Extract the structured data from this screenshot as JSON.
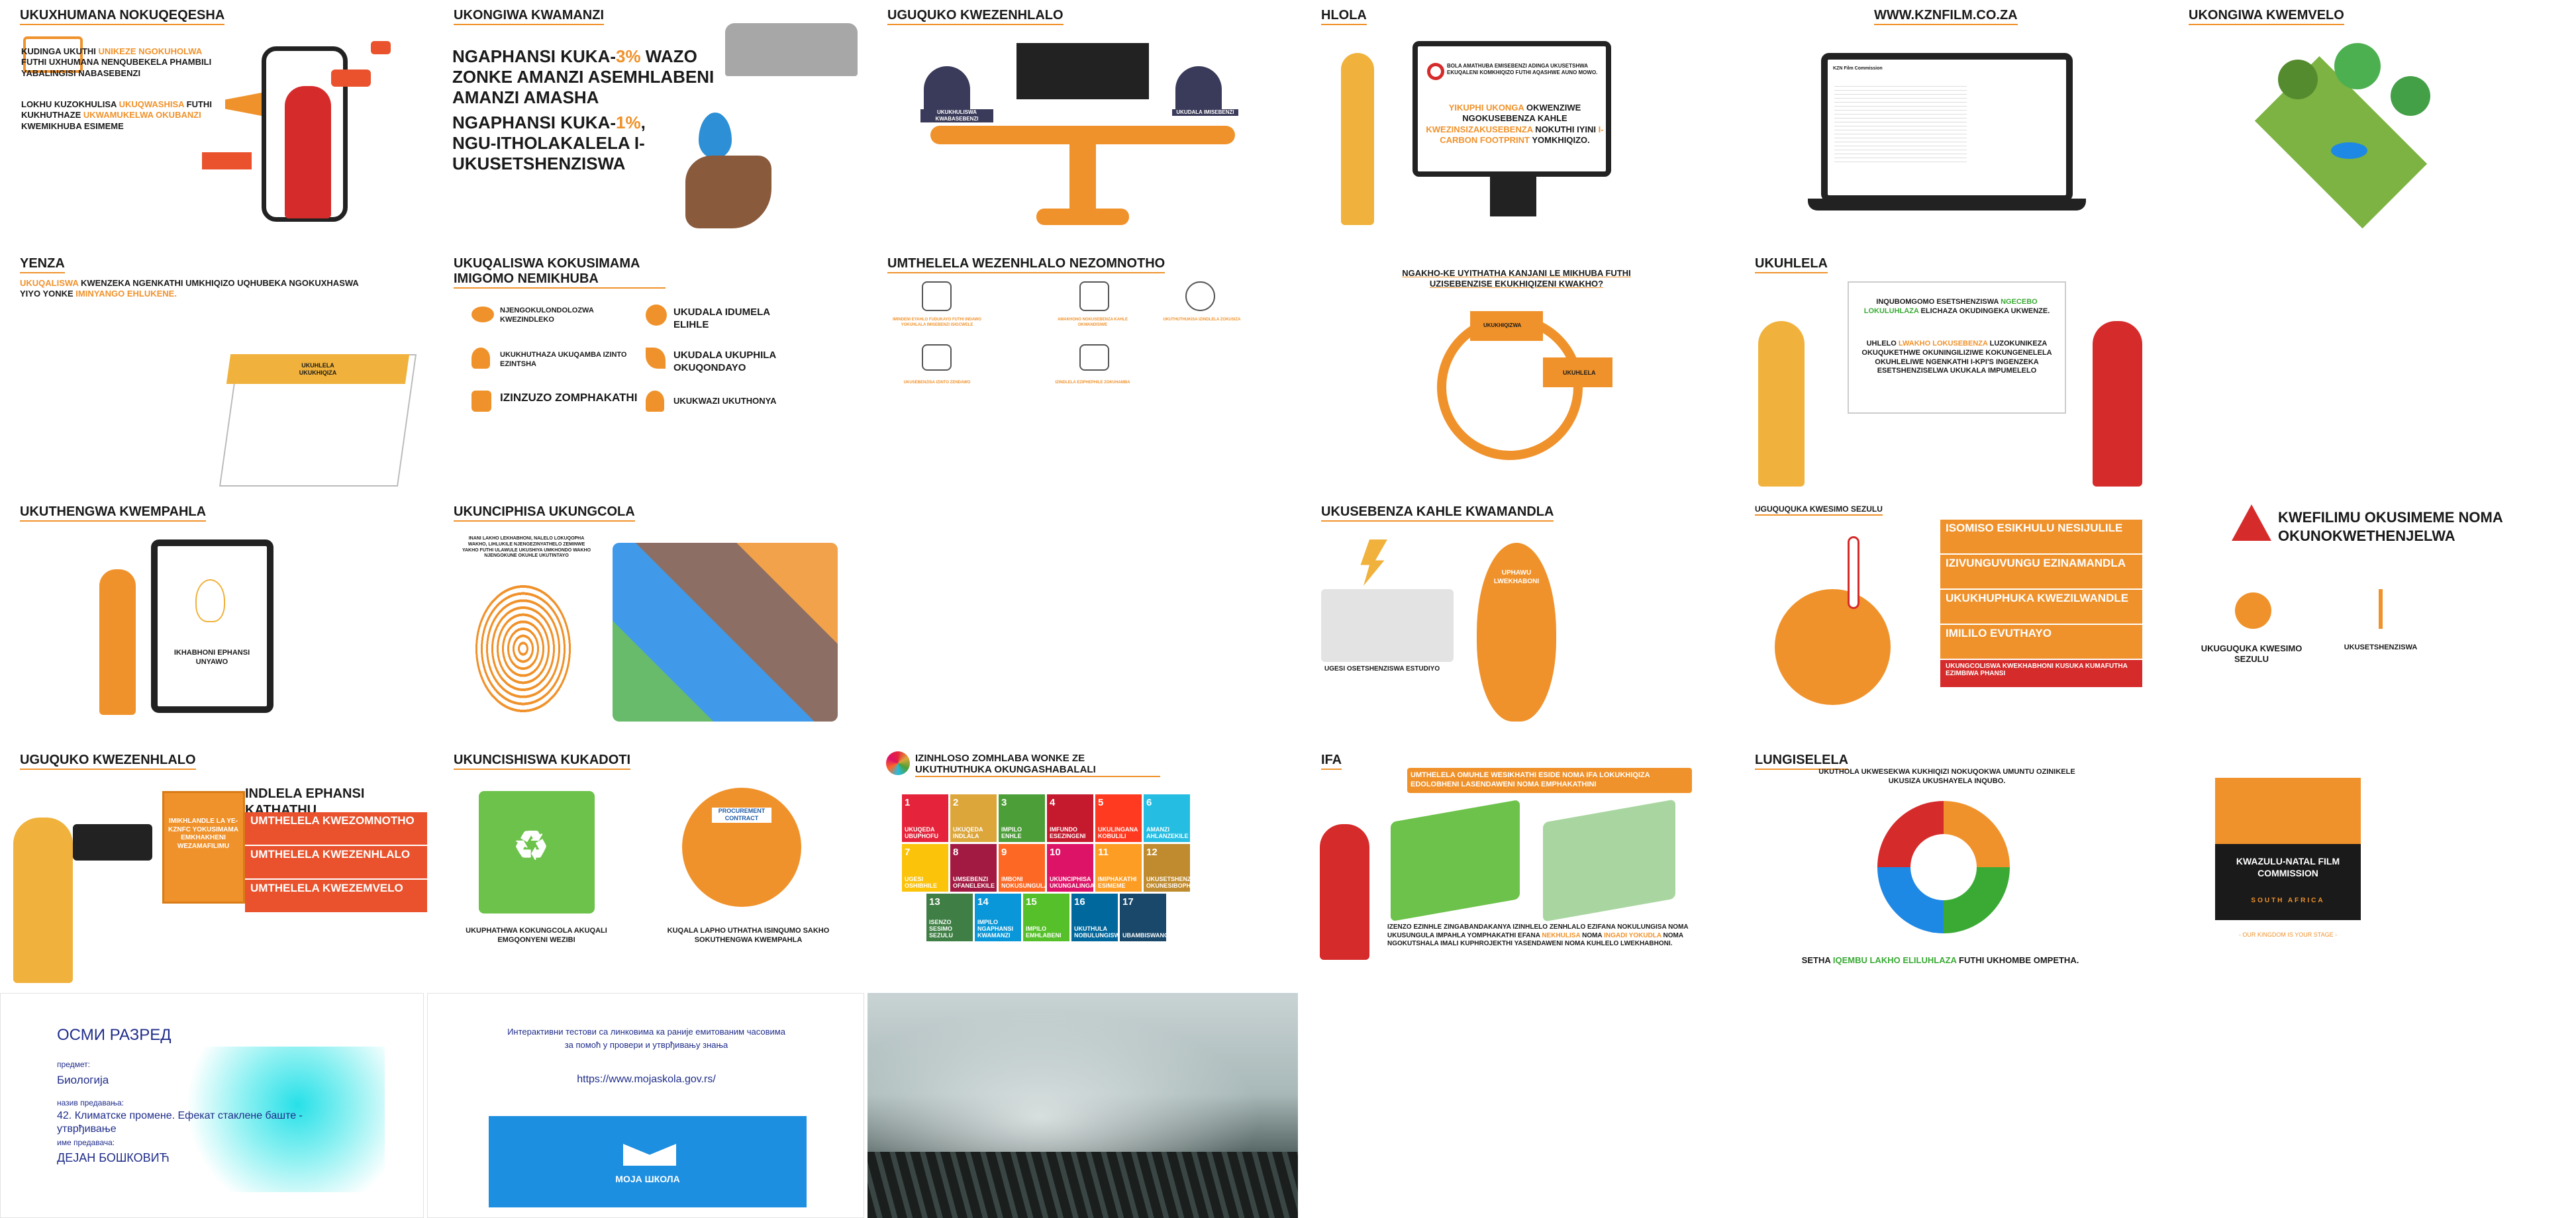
{
  "slides": [
    {
      "title": "UKUXHUMANA NOKUQEQESHA",
      "p1": [
        "KUDINGA UKUTHI ",
        "UNIKEZE NGOKUHOLWA",
        " FUTHI UXHUMANA NENQUBEKELA PHAMBILI YABALINGISI NABASEBENZI"
      ],
      "p2": [
        "LOKHU KUZOKHULISA ",
        "UKUQWASHISA",
        " FUTHI KUKHUTHAZE ",
        "UKWAMUKELWA OKUBANZI",
        " KWEMIKHUBA ESIMEME"
      ]
    },
    {
      "title": "UKONGIWA KWAMANZI",
      "l1": [
        "NGAPHANSI KUKA-",
        "3%",
        " WAZO ZONKE AMANZI ASEMHLABENI AMANZI AMASHA"
      ],
      "l2": [
        "NGAPHANSI KUKA-",
        "1%",
        ", NGU-ITHOLAKALELA I-UKUSETSHENZISWA"
      ]
    },
    {
      "title": "UGUQUKO KWEZENHLALO",
      "left": "UKUKHULISWA KWABASEBENZI",
      "right": "UKUDALA IMISEBENZI"
    },
    {
      "title": "HLOLA",
      "p1": "BOLA AMATHUBA EMISEBENZI ADINGA UKUSETSHWA EKUQALENI KOMKHIQIZO FUTHI AQASHWE AUNO MOWO.",
      "p2": [
        "YIKUPHI UKONGA",
        " OKWENZIWE NGOKUSEBENZA KAHLE ",
        "KWEZINSIZAKUSEBENZA",
        " NOKUTHI IYINI ",
        "I-CARBON FOOTPRINT",
        " YOMKHIQIZO."
      ]
    },
    {
      "title": "WWW.KZNFILM.CO.ZA",
      "site": "KZN Film Commission"
    },
    {
      "title": "UKONGIWA KWEMVELO"
    },
    {
      "title": "YENZA",
      "p1": [
        "UKUQALISWA",
        " KWENZEKA NGENKATHI UMKHIQIZO UQHUBEKA NGOKUXHASWA YIYO YONKE ",
        "IMINYANGO EHLUKENE."
      ],
      "cal": "UKUHLELA UKUKHIQIZA"
    },
    {
      "title": "UKUQALISWA KOKUSIMAMA IMIGOMO NEMIKHUBA",
      "items": [
        "NJENGOKULONDOLOZWA KWEZINDLEKO",
        "UKUDALA IDUMELA ELIHLE",
        "UKUKHUTHAZA UKUQAMBA IZINTO EZINTSHA",
        "UKUDALA UKUPHILA OKUQONDAYO",
        "IZINZUZO ZOMPHAKATHI",
        "UKUKWAZI UKUTHONYA"
      ]
    },
    {
      "title": "UMTHELELA WEZENHLALO NEZOMNOTHO",
      "items": [
        "IMINDENI EYAHLO FUDUKAYO FUTHI INDAWO YOKUHLALA IMISEBENZI ISIGCWELE",
        "AMAKHONO NOKUSEBENZA KAHLE OKWANDISIWE",
        "UKUTHUTHUKISA IZINDLELA ZOKUSIZA",
        "UKUSEBENZISA IZINTO ZENDAWO",
        "IZINDLELA EZIPHEPHILE ZOKUHAMBA",
        "IMIPHUMELA EHLE YEZEMPILO"
      ]
    },
    {
      "title": "",
      "q": "NGAKHO-KE UYITHATHA KANJANI LE MIKHUBA FUTHI UZISEBENZISE EKUKHIQIZENI KWAKHO?",
      "a": "UKUKHIQIZWA",
      "b": "UKUHLELA"
    },
    {
      "title": "UKUHLELA",
      "p1": [
        "INQUBOMGOMO ESETSHENZISWA ",
        "NGECEBO LOKULUHLAZA",
        " ELICHAZA OKUDINGEKA UKWENZE."
      ],
      "p2": [
        "UHLELO ",
        "LWAKHO LOKUSEBENZA",
        " LUZOKUNIKEZA OKUQUKETHWE OKUNINGILIZIWE KOKUNGENELELA OKUHLELIWE NGENKATHI I-KPI'S INGENZEKA ESETSHENZISELWA UKUKALA IMPUMELELO"
      ]
    },
    {
      "title": "UKUTHENGWA KWEMPAHLA",
      "phone": "IKHABHONI EPHANSI UNYAWO"
    },
    {
      "title": "UKUNCIPHISA UKUNGCOLA",
      "p1": "INANI LAKHO LEKHABHONI, NALELO LOKUQOPHA WAKHO, LIHLUKILE NJENGEZINYATHELO ZEMINWE YAKHO FUTHI ULAWULE UKUSHIYA UMKHONDO WAKHO NJENGOKUNE OKUHLE UKUTINTAYO"
    },
    {
      "title": "UKUSEBENZA KAHLE KWAMANDLA",
      "studio": "UGESI OSETSHENZISWA ESTUDIYO",
      "foot": "UPHAWU LWEKHABONI"
    },
    {
      "title": "UGUQUQUKA KWESIMO SEZULU",
      "rows": [
        "ISOMISO ESIKHULU NESIJULILE",
        "IZIVUNGUVUNGU EZINAMANDLA",
        "UKUKHUPHUKA KWEZILWANDLE",
        "IMILILO EVUTHAYO",
        "UKUNGCOLISWA KWEKHABHONI KUSUKA KUMAFUTHA EZIMBIWA PHANSI"
      ]
    },
    {
      "title": "",
      "warn": "KWEFILIMU OKUSIMEME NOMA OKUNOKWETHENJELWA",
      "l": "UKUGUQUKA KWESIMO SEZULU",
      "r": "UKUSETSHENZISWA"
    },
    {
      "title": "UGUQUKO KWEZENHLALO",
      "book": "IMIKHLANDLE LA YE-KZNFC YOKUSIMAMA EMKHAKHENI WEZAMAFILIMU",
      "ind": "INDLELA EPHANSI KATHATHU",
      "rows": [
        "UMTHELELA KWEZOMNOTHO",
        "UMTHELELA KWEZENHLALO",
        "UMTHELELA KWEZEMVELO"
      ]
    },
    {
      "title": "UKUNCISHISWA KUKADOTI",
      "c1": "UKUPHATHWA KOKUNGCOLA AKUQALI EMGQONYENI WEZIBI",
      "c2": "KUQALA LAPHO UTHATHA ISINQUMO SAKHO SOKUTHENGWA KWEMPAHLA",
      "contract": "PROCUREMENT CONTRACT"
    },
    {
      "title": "IZINHLOSO ZOMHLABA WONKE ZE UKUTHUTHUKA OKUNGASHABALALI",
      "sdg": [
        {
          "n": "1",
          "t": "UKUQEDA UBUPHOFU",
          "c": "#e5243b"
        },
        {
          "n": "2",
          "t": "UKUQEDA INDLALA",
          "c": "#dda63a"
        },
        {
          "n": "3",
          "t": "IMPILO ENHLE",
          "c": "#4c9f38"
        },
        {
          "n": "4",
          "t": "IMFUNDO ESEZINGENI",
          "c": "#c5192d"
        },
        {
          "n": "5",
          "t": "UKULINGANA KOBULILI",
          "c": "#ff3a21"
        },
        {
          "n": "6",
          "t": "AMANZI AHLANZEKILE",
          "c": "#26bde2"
        },
        {
          "n": "7",
          "t": "UGESI OSHIBHILE",
          "c": "#fcc30b"
        },
        {
          "n": "8",
          "t": "UMSEBENZI OFANELEKILE",
          "c": "#a21942"
        },
        {
          "n": "9",
          "t": "IMBONI NOKUSUNGULA",
          "c": "#fd6925"
        },
        {
          "n": "10",
          "t": "UKUNCIPHISA UKUNGALINGANI",
          "c": "#dd1367"
        },
        {
          "n": "11",
          "t": "IMIPHAKATHI ESIMEME",
          "c": "#fd9d24"
        },
        {
          "n": "12",
          "t": "UKUSETSHENZISWA OKUNESIBOPHO",
          "c": "#bf8b2e"
        },
        {
          "n": "13",
          "t": "ISENZO SESIMO SEZULU",
          "c": "#3f7e44"
        },
        {
          "n": "14",
          "t": "IMPILO NGAPHANSI KWAMANZI",
          "c": "#0a97d9"
        },
        {
          "n": "15",
          "t": "IMPILO EMHLABENI",
          "c": "#56c02b"
        },
        {
          "n": "16",
          "t": "UKUTHULA NOBULUNGISWA",
          "c": "#00689d"
        },
        {
          "n": "17",
          "t": "UBAMBISWANO",
          "c": "#19486a"
        }
      ]
    },
    {
      "title": "IFA",
      "banner": "UMTHELELA OMUHLE WESIKHATHI ESIDE NOMA IFA LOKUKHIQIZA EDOLOBHENI LASENDAWENI NOMA EMPHAKATHINI",
      "p": [
        "IZENZO EZINHLE ZINGABANDAKANYA IZINHLELO ZENHLALO EZIFANA NOKULUNGISA NOMA UKUSUNGULA IMPAHLA YOMPHAKATHI EFANA ",
        "NEKHULISA",
        " NOMA ",
        "INGADI YOKUDLA",
        " NOMA NGOKUTSHALA IMALI KUPHROJEKTHI YASENDAWENI NOMA KUHLELO LWEKHABHONI."
      ]
    },
    {
      "title": "LUNGISELELA",
      "p1": "UKUTHOLA UKWESEKWA KUKHIQIZI NOKUQOKWA UMUNTU OZINIKELE UKUSIZA UKUSHAYELA INQUBO.",
      "p2": [
        "SETHA ",
        "IQEMBU LAKHO ELILUHLAZA",
        " FUTHI UKHOMBE OMPETHA."
      ]
    },
    {
      "title": "",
      "logo": "KWAZULU-NATAL FILM COMMISSION",
      "sa": "SOUTH AFRICA",
      "slogan": "- OUR KINGDOM IS YOUR STAGE -"
    },
    {
      "title": "ОСМИ РАЗРЕД",
      "subject_label": "предмет:",
      "subject": "Биологија",
      "lecture_label": "назив предавања:",
      "lecture": "42. Климатске промене. Ефекат стаклене баште - утврђивање",
      "teacher_label": "име предавача:",
      "teacher": "ДЕЈАН БОШКОВИЋ"
    },
    {
      "title": "",
      "l1": "Интерактивни тестови са линковима ка раније емитованим часовима",
      "l2": "за помоћ у провери и утврђивању знања",
      "url": "https://www.mojaskola.gov.rs/",
      "logo": "МОЈА ШКОЛА"
    },
    {
      "title": ""
    }
  ]
}
